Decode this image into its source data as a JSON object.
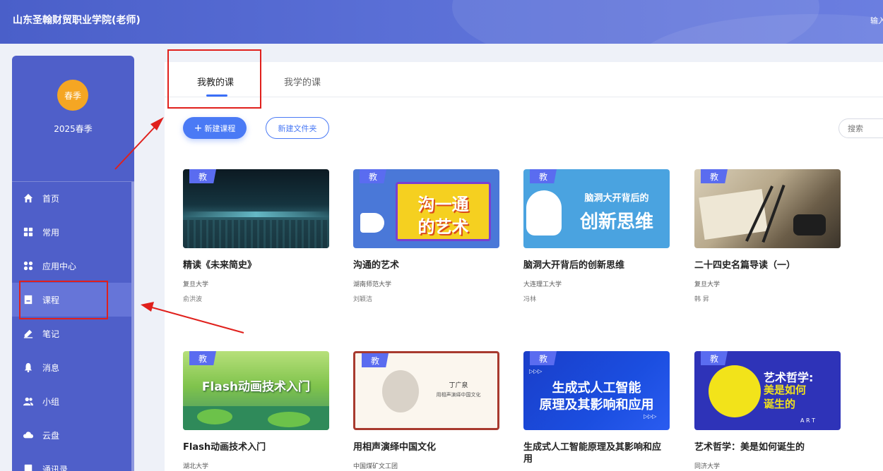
{
  "header": {
    "school_name": "山东圣翰财贸职业学院(老师)",
    "right_text": "输入"
  },
  "sidebar": {
    "avatar_label": "春季",
    "term_label": "2025春季",
    "items": [
      {
        "label": "首页",
        "icon": "home-icon"
      },
      {
        "label": "常用",
        "icon": "grid-icon"
      },
      {
        "label": "应用中心",
        "icon": "apps-icon"
      },
      {
        "label": "课程",
        "icon": "book-icon",
        "active": true
      },
      {
        "label": "笔记",
        "icon": "pen-icon"
      },
      {
        "label": "消息",
        "icon": "bell-icon"
      },
      {
        "label": "小组",
        "icon": "group-icon"
      },
      {
        "label": "云盘",
        "icon": "cloud-icon"
      },
      {
        "label": "通讯录",
        "icon": "contacts-icon"
      }
    ]
  },
  "tabs": [
    {
      "label": "我教的课",
      "active": true
    },
    {
      "label": "我学的课"
    }
  ],
  "toolbar": {
    "new_course_label": "新建课程",
    "new_folder_label": "新建文件夹",
    "search_placeholder": "搜索"
  },
  "courses": [
    {
      "badge": "教",
      "title": "精读《未来简史》",
      "school": "复旦大学",
      "teacher": "俞洪波",
      "cover_text": ""
    },
    {
      "badge": "教",
      "title": "沟通的艺术",
      "school": "湖南师范大学",
      "teacher": "刘颖洁",
      "cover_text_1": "沟一通",
      "cover_text_2": "的艺术"
    },
    {
      "badge": "教",
      "title": "脑洞大开背后的创新思维",
      "school": "大连理工大学",
      "teacher": "冯林",
      "cover_text_1": "脑洞大开背后的",
      "cover_text_2": "创新思维"
    },
    {
      "badge": "教",
      "title": "二十四史名篇导读（一）",
      "school": "复旦大学",
      "teacher": "韩 昇",
      "cover_text": ""
    },
    {
      "badge": "教",
      "title": "Flash动画技术入门",
      "school": "湖北大学",
      "teacher": "",
      "cover_text_1": "Flash动画技术入门"
    },
    {
      "badge": "教",
      "title": "用相声演绎中国文化",
      "school": "中国煤矿文工团",
      "teacher": "",
      "cover_text_1": "丁广泉",
      "cover_text_2": "用相声演绎中国文化"
    },
    {
      "badge": "教",
      "title": "生成式人工智能原理及其影响和应用",
      "school": "",
      "teacher": "",
      "cover_text_1": "生成式人工智能",
      "cover_text_2": "原理及其影响和应用",
      "cover_text_3": "▷▷▷"
    },
    {
      "badge": "教",
      "title": "艺术哲学：美是如何诞生的",
      "school": "同济大学",
      "teacher": "",
      "cover_text_1": "艺术哲学:",
      "cover_text_2": "美是如何",
      "cover_text_3": "诞生的",
      "cover_text_4": "A R T"
    }
  ],
  "colors": {
    "accent": "#4a7af5",
    "sidebar": "#4f5fc9",
    "annotation": "#e0201c"
  }
}
